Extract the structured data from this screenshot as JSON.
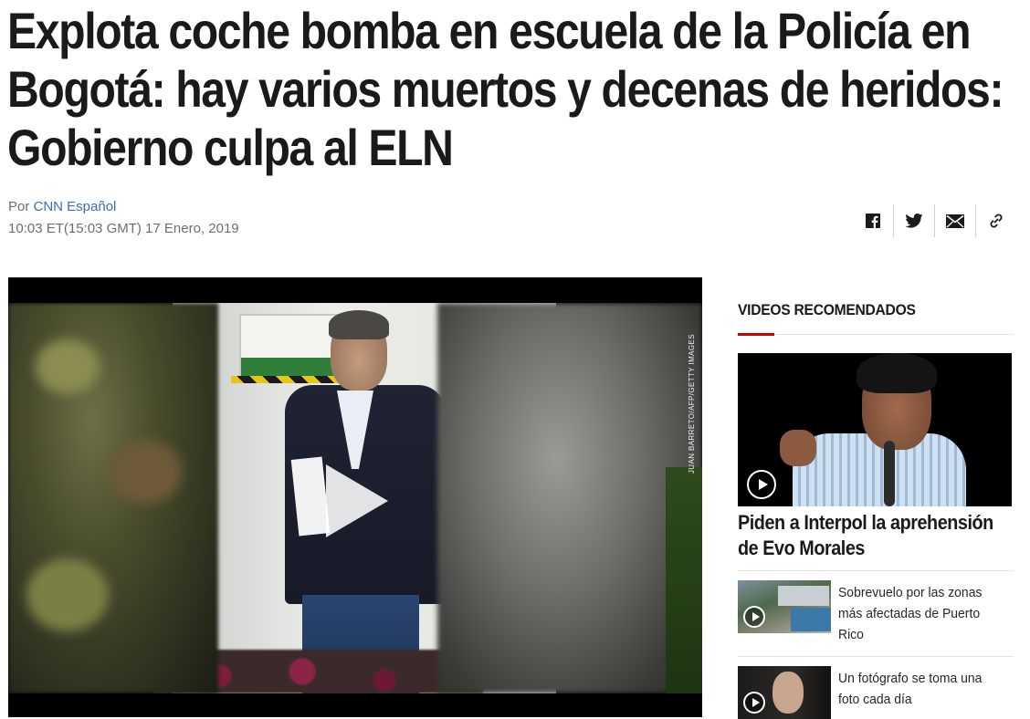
{
  "article": {
    "headline": "Explota coche bomba en escuela de la Policía en Bogotá: hay varios muertos y decenas de heridos: Gobierno culpa al ELN",
    "byline_prefix": "Por",
    "author": "CNN Español",
    "timestamp": "10:03 ET(15:03 GMT) 17 Enero, 2019"
  },
  "share": {
    "buttons": [
      {
        "icon": "facebook-icon"
      },
      {
        "icon": "twitter-icon"
      },
      {
        "icon": "email-icon"
      },
      {
        "icon": "link-icon"
      }
    ]
  },
  "video": {
    "photo_credit": "JUAN BARRETO/AFP/GETTY IMAGES",
    "play_icon": "play-icon"
  },
  "sidebar": {
    "title": "VIDEOS RECOMENDADOS",
    "feature": {
      "title": "Piden a Interpol la aprehensión de Evo Morales"
    },
    "items": [
      {
        "title": "Sobrevuelo por las zonas más afectadas de Puerto Rico"
      },
      {
        "title": "Un fotógrafo se toma una foto cada día"
      }
    ]
  },
  "colors": {
    "link": "#3c6bc4",
    "accent": "#cc0000",
    "meta_text": "#6e6e6e"
  }
}
